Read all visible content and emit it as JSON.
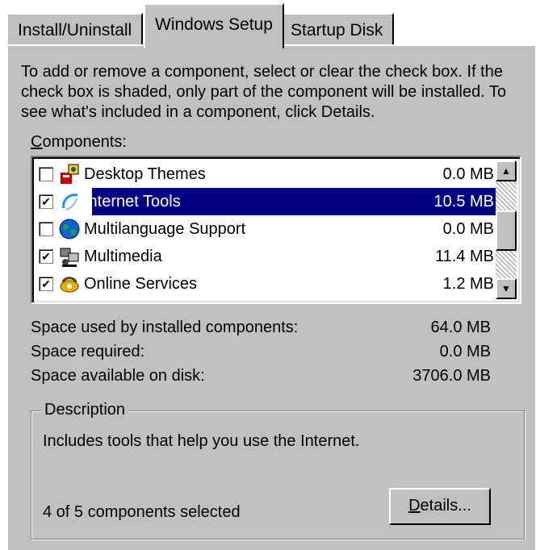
{
  "tabs": [
    {
      "label": "Install/Uninstall"
    },
    {
      "label": "Windows Setup"
    },
    {
      "label": "Startup Disk"
    }
  ],
  "instructions": "To add or remove a component, select or clear the check box. If the check box is shaded, only part of the component will be installed. To see what's included in a component, click Details.",
  "components_label": {
    "mnemonic": "C",
    "rest": "omponents:"
  },
  "components": [
    {
      "name": "Desktop Themes",
      "size": "0.0 MB",
      "checked": false,
      "icon": "desktop-themes-icon"
    },
    {
      "name": "Internet Tools",
      "size": "10.5 MB",
      "checked": true,
      "selected": true,
      "icon": "internet-tools-icon"
    },
    {
      "name": "Multilanguage Support",
      "size": "0.0 MB",
      "checked": false,
      "icon": "globe-icon"
    },
    {
      "name": "Multimedia",
      "size": "11.4 MB",
      "checked": true,
      "icon": "multimedia-icon"
    },
    {
      "name": "Online Services",
      "size": "1.2 MB",
      "checked": true,
      "icon": "online-services-icon"
    }
  ],
  "space": {
    "used_label": "Space used by installed components:",
    "used_value": "64.0 MB",
    "required_label": "Space required:",
    "required_value": "0.0 MB",
    "available_label": "Space available on disk:",
    "available_value": "3706.0 MB"
  },
  "description": {
    "legend": "Description",
    "text": "Includes tools that help you use the Internet.",
    "count": "4 of 5 components selected",
    "details_button": {
      "mnemonic": "D",
      "rest": "etails..."
    }
  },
  "colors": {
    "face": "#c0c0c0",
    "selection": "#000080",
    "window": "#ffffff"
  }
}
